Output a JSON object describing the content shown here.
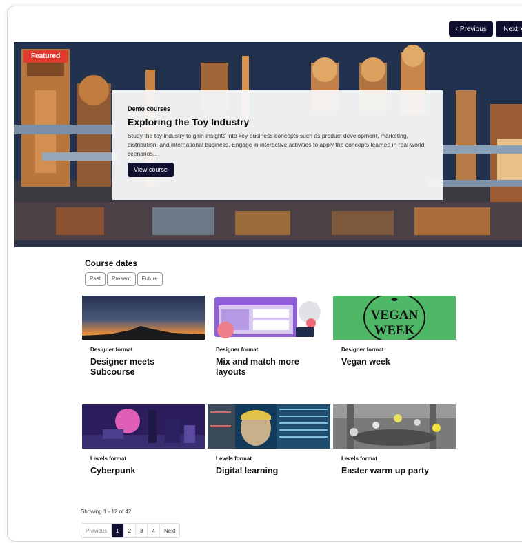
{
  "nav": {
    "previous_label": "Previous",
    "next_label": "Next"
  },
  "hero": {
    "badge": "Featured",
    "kicker": "Demo courses",
    "title": "Exploring the Toy Industry",
    "description": "Study the toy industry to gain insights into key business concepts such as product development, marketing, distribution, and international business. Engage in interactive activities to apply the concepts learned in real-world scenarios...",
    "button_label": "View course"
  },
  "course_dates": {
    "title": "Course dates",
    "filters": [
      "Past",
      "Present",
      "Future"
    ]
  },
  "courses": [
    {
      "kicker": "Designer format",
      "title": "Designer meets Subcourse"
    },
    {
      "kicker": "Designer format",
      "title": "Mix and match more layouts"
    },
    {
      "kicker": "Designer format",
      "title": "Vegan week",
      "image_text_1": "VEGAN",
      "image_text_2": "WEEK"
    },
    {
      "kicker": "Levels format",
      "title": "Cyberpunk"
    },
    {
      "kicker": "Levels format",
      "title": "Digital learning"
    },
    {
      "kicker": "Levels format",
      "title": "Easter warm up party"
    }
  ],
  "pagination": {
    "showing": "Showing 1 - 12 of 42",
    "previous": "Previous",
    "pages": [
      "1",
      "2",
      "3",
      "4"
    ],
    "current": "1",
    "next": "Next"
  },
  "colors": {
    "primary": "#0f1030",
    "badge": "#e23a2e",
    "vegan_bg": "#4fb866"
  }
}
